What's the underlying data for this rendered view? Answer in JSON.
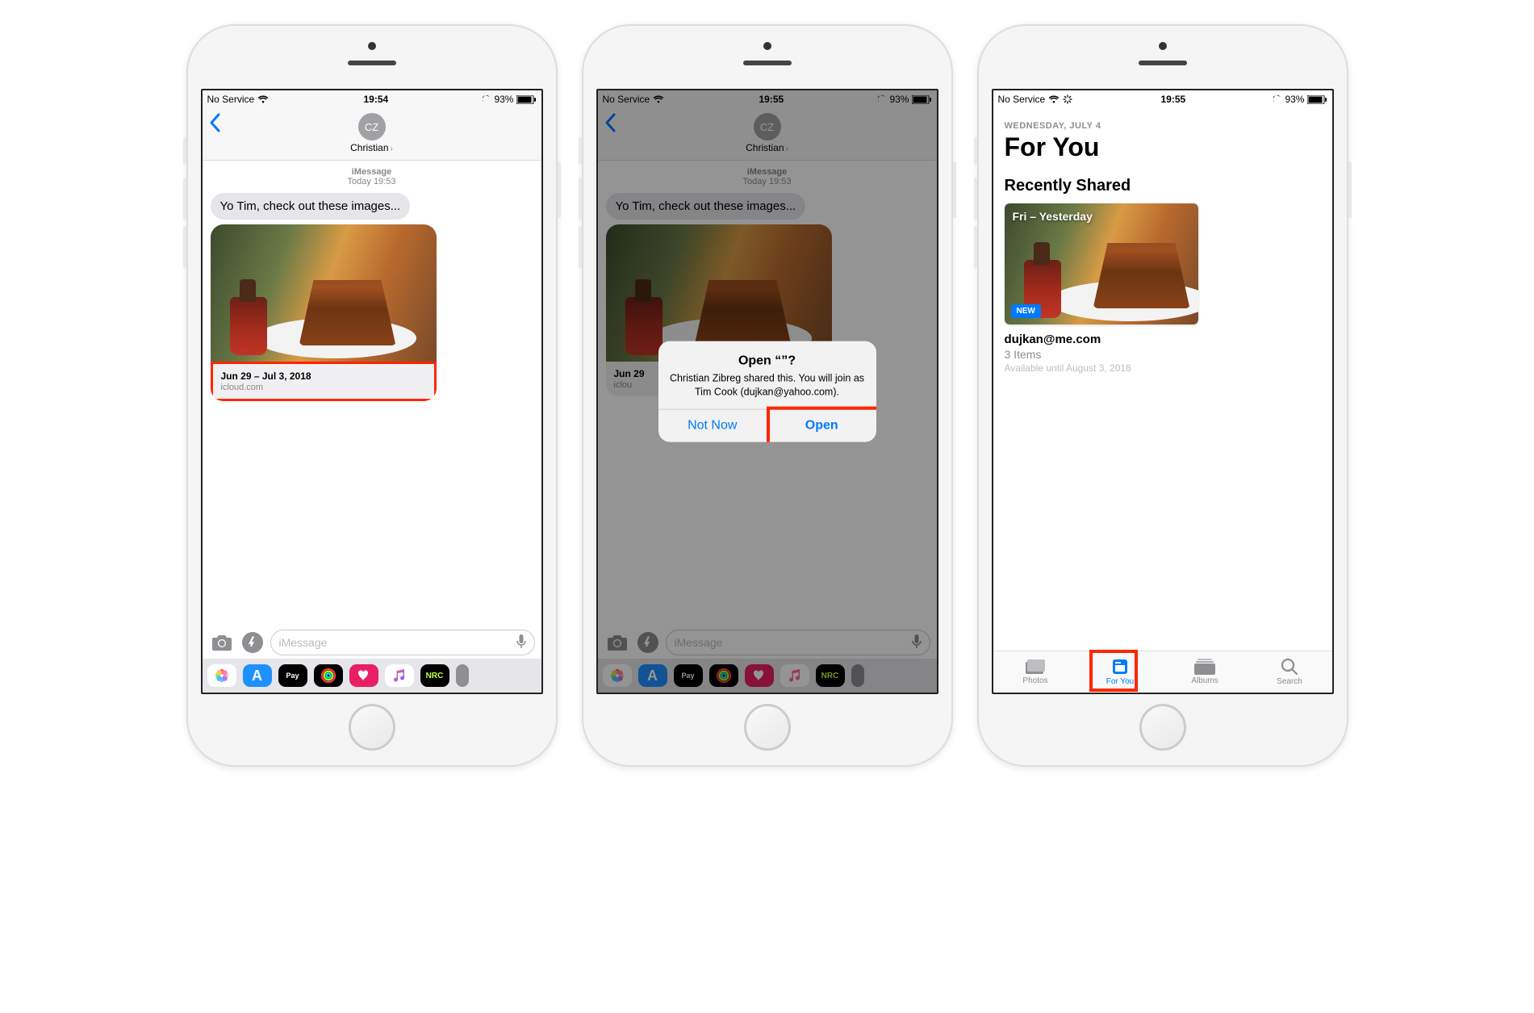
{
  "screen1": {
    "status": {
      "carrier": "No Service",
      "time": "19:54",
      "battery": "93%"
    },
    "contact": {
      "initials": "CZ",
      "name": "Christian"
    },
    "thread": {
      "service": "iMessage",
      "timestamp": "Today 19:53"
    },
    "bubble": "Yo Tim, check out these images...",
    "attachment": {
      "title": "Jun 29 – Jul 3, 2018",
      "source": "icloud.com"
    },
    "input_placeholder": "iMessage",
    "apps": [
      "Photos",
      "Store",
      "Pay",
      "Activity",
      "Heart",
      "Music",
      "NRC"
    ]
  },
  "screen2": {
    "status": {
      "carrier": "No Service",
      "time": "19:55",
      "battery": "93%"
    },
    "contact": {
      "initials": "CZ",
      "name": "Christian"
    },
    "thread": {
      "service": "iMessage",
      "timestamp": "Today 19:53"
    },
    "bubble": "Yo Tim, check out these images...",
    "attachment": {
      "title": "Jun 29",
      "source": "iclou"
    },
    "alert": {
      "title": "Open “”?",
      "message": "Christian Zibreg shared this. You will join as Tim Cook (dujkan@yahoo.com).",
      "cancel": "Not Now",
      "confirm": "Open"
    },
    "input_placeholder": "iMessage"
  },
  "screen3": {
    "status": {
      "carrier": "No Service",
      "time": "19:55",
      "battery": "93%"
    },
    "eyebrow": "WEDNESDAY, JULY 4",
    "title": "For You",
    "section": "Recently Shared",
    "card": {
      "overlay": "Fri – Yesterday",
      "badge": "NEW",
      "line1": "dujkan@me.com",
      "line2": "3 Items",
      "line3": "Available until August 3, 2018"
    },
    "tabs": {
      "photos": "Photos",
      "foryou": "For You",
      "albums": "Albums",
      "search": "Search"
    }
  },
  "colors": {
    "accent": "#007aff",
    "highlight": "#ff2600"
  }
}
